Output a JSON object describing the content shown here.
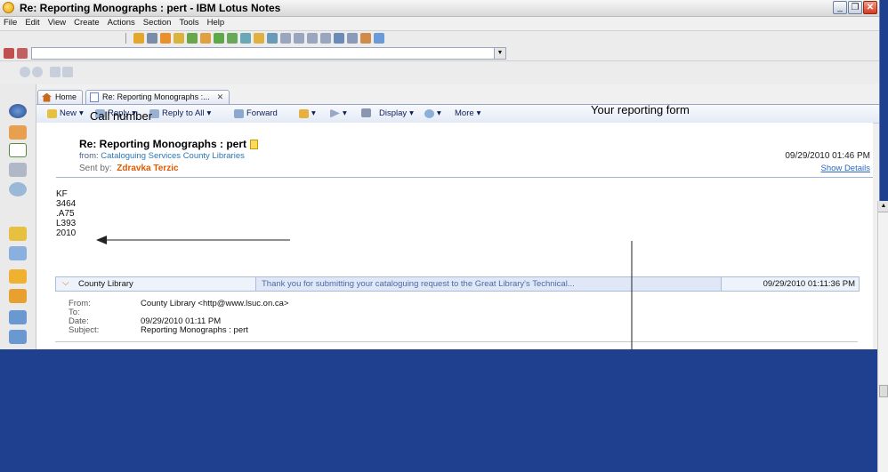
{
  "window": {
    "title": "Re: Reporting Monographs : pert - IBM Lotus Notes"
  },
  "menubar": [
    "File",
    "Edit",
    "View",
    "Create",
    "Actions",
    "Section",
    "Tools",
    "Help"
  ],
  "tabs": [
    {
      "label": "Home"
    },
    {
      "label": "Re: Reporting Monographs :..."
    }
  ],
  "actionbar": {
    "new": "New",
    "reply": "Reply",
    "reply_all": "Reply to All",
    "forward": "Forward",
    "display": "Display",
    "more": "More"
  },
  "message": {
    "subject": "Re: Reporting Monographs : pert",
    "from_label": "from:",
    "from": "Cataloguing Services County Libraries",
    "sent_by_label": "Sent by:",
    "sent_by": "Zdravka Terzic",
    "date": "09/29/2010 01:46 PM",
    "show_details": "Show Details",
    "body_lines": [
      "KF",
      "3464",
      ".A75",
      "L393",
      "2010"
    ]
  },
  "annotations": {
    "call_number": "Call number",
    "reporting_form": "Your reporting form"
  },
  "thread": {
    "sender": "County Library",
    "snippet": "Thank you for submitting your cataloguing request to the Great Library's Technical...",
    "date": "09/29/2010 01:11:36 PM"
  },
  "quoted": {
    "labels": [
      "From:",
      "To:",
      "Date:",
      "Subject:"
    ],
    "values": [
      "County Library <http@www.lsuc.on.ca>",
      "",
      "09/29/2010 01:11 PM",
      "Reporting Monographs : pert"
    ]
  },
  "colors": {
    "accent_blue": "#1f3f8f",
    "sender_orange": "#e05a00",
    "link_blue": "#2b77b6"
  }
}
